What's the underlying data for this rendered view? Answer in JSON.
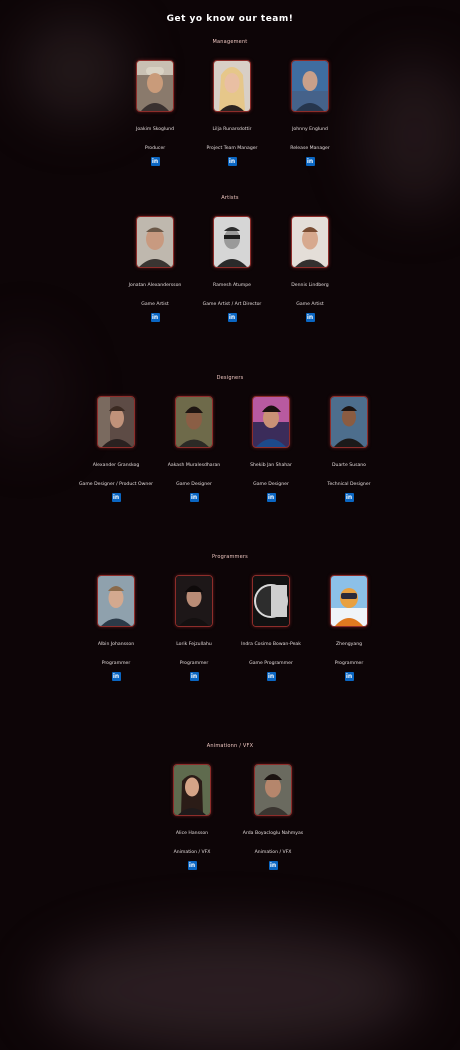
{
  "page": {
    "heading": "Get yo know our team!"
  },
  "colors": {
    "background": "#0d0507",
    "accent": "#8d2d2a",
    "section_title": "#efc7c1",
    "linkedin": "#0a66c2"
  },
  "icons": {
    "linkedin": "linkedin-icon"
  },
  "sections": [
    {
      "title": "Management",
      "members": [
        {
          "name": "Joakim Skoglund",
          "role": "Producer",
          "linkedin": "in"
        },
        {
          "name": "Lilja Runarsdottir",
          "role": "Project Team Manager",
          "linkedin": "in"
        },
        {
          "name": "Johnny Englund",
          "role": "Release Manager",
          "linkedin": "in"
        }
      ]
    },
    {
      "title": "Artists",
      "members": [
        {
          "name": "Jonatan Alexandersson",
          "role": "Game Artist",
          "linkedin": "in"
        },
        {
          "name": "Ramesh Atumpe",
          "role": "Game Artist / Art Director",
          "linkedin": "in"
        },
        {
          "name": "Dennis Lindberg",
          "role": "Game Artist",
          "linkedin": "in"
        }
      ]
    },
    {
      "title": "Designers",
      "members": [
        {
          "name": "Alexander Granskog",
          "role": "Game Designer / Product Owner",
          "linkedin": "in"
        },
        {
          "name": "Aakash Muralesdharan",
          "role": "Game Designer",
          "linkedin": "in"
        },
        {
          "name": "Shekib Jan Shahar",
          "role": "Game Designer",
          "linkedin": "in"
        },
        {
          "name": "Duarte Susano",
          "role": "Technical Designer",
          "linkedin": "in"
        }
      ]
    },
    {
      "title": "Programmers",
      "members": [
        {
          "name": "Albin Johansson",
          "role": "Programmer",
          "linkedin": "in"
        },
        {
          "name": "Lorik Fejzullahu",
          "role": "Programmer",
          "linkedin": "in"
        },
        {
          "name": "Indra Cosimo Bowan-Peak",
          "role": "Game Programmer",
          "linkedin": "in"
        },
        {
          "name": "Zhengyang",
          "role": "Programmer",
          "linkedin": "in"
        }
      ]
    },
    {
      "title": "Animationn / VFX",
      "members": [
        {
          "name": "Alice Hansson",
          "role": "Animation / VFX",
          "linkedin": "in"
        },
        {
          "name": "Arda Boyacloglu Nahmyas",
          "role": "Animation / VFX",
          "linkedin": "in"
        }
      ]
    }
  ]
}
